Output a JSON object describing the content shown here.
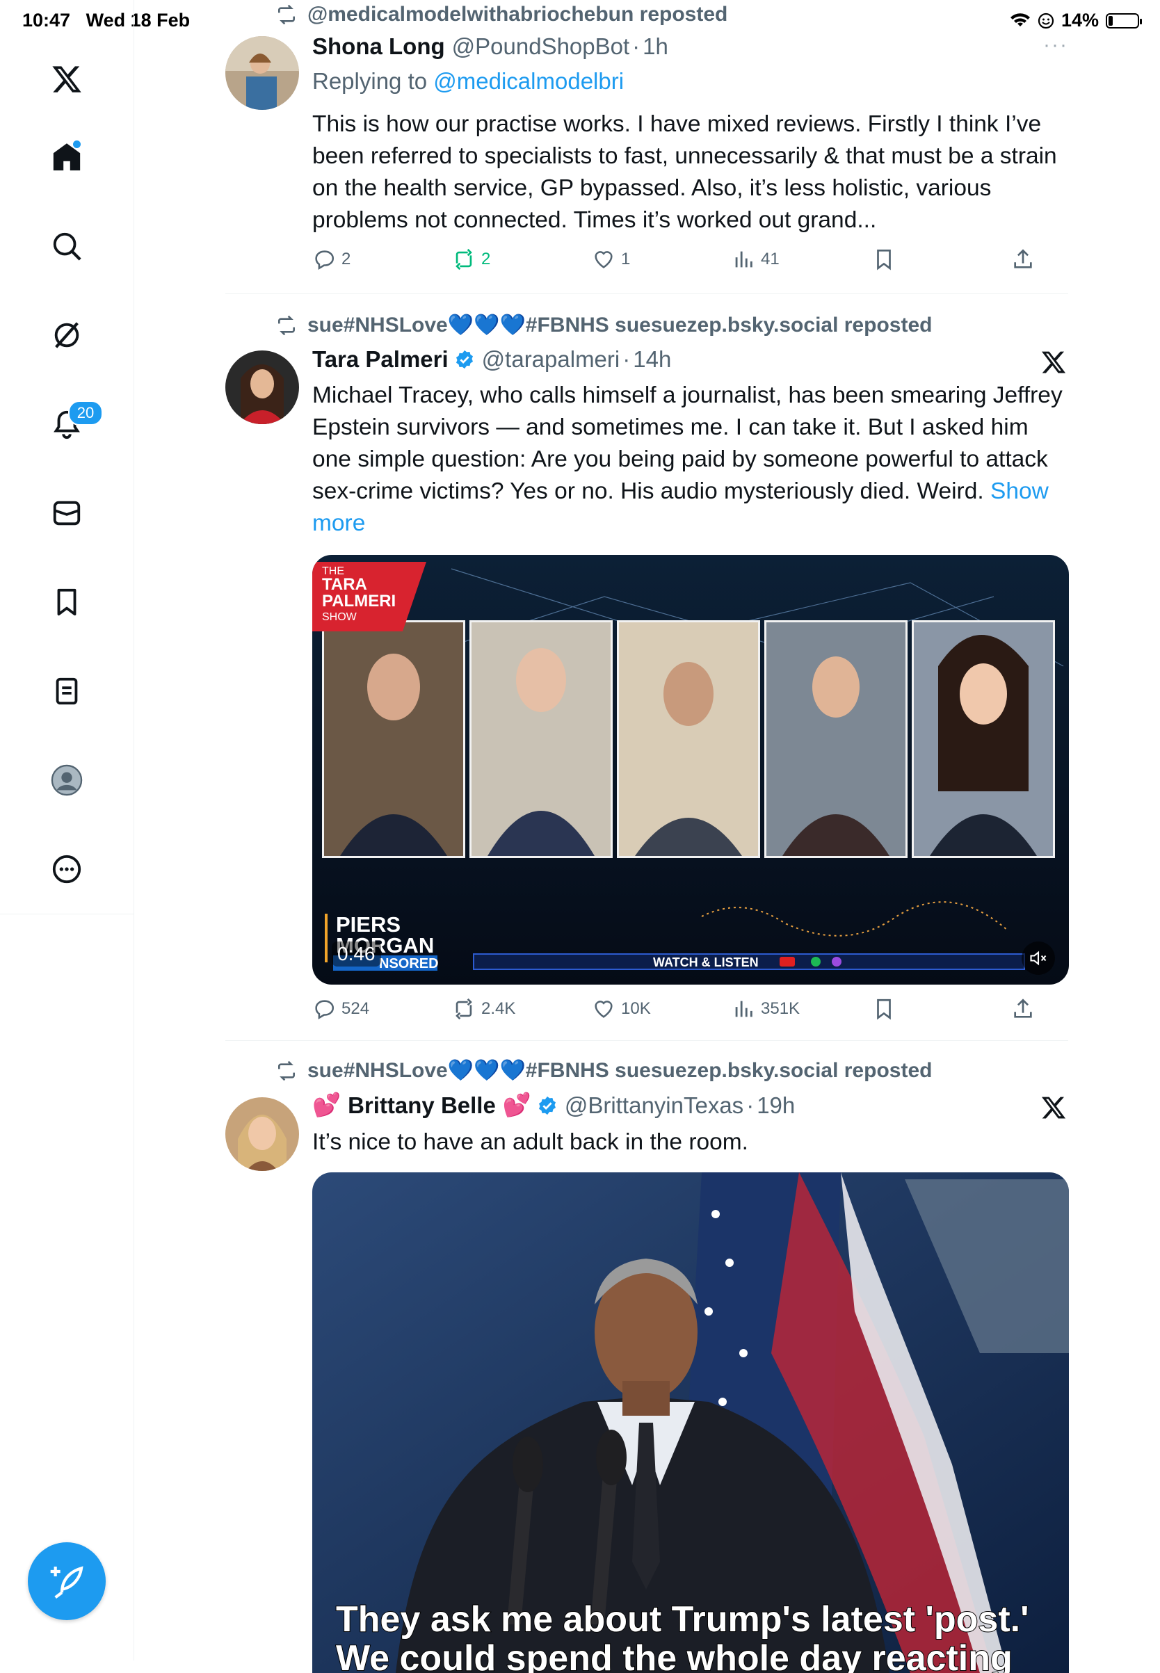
{
  "status_bar": {
    "time": "10:47",
    "date": "Wed 18 Feb",
    "battery": "14%",
    "battery_level": 0.14
  },
  "sidebar": {
    "notifications_badge": "20",
    "items": [
      "x-logo",
      "home",
      "explore",
      "grok",
      "notifications",
      "messages",
      "bookmarks",
      "lists",
      "profile",
      "more"
    ]
  },
  "tweets": [
    {
      "repost_by": "@medicalmodelwithabriochebun reposted",
      "name": "Shona Long",
      "handle": "@PoundShopBot",
      "sep": "·",
      "time": "1h",
      "more": "···",
      "reply_label": "Replying to",
      "reply_handle": "@medicalmodelbri",
      "text": "This is how our practise works. I have mixed reviews. Firstly I think I’ve been referred to specialists to fast, unnecessarily & that must be a strain on the health service, GP bypassed. Also, it’s less holistic, various problems not connected. Times it’s worked out grand...",
      "replies": "2",
      "reposts": "2",
      "likes": "1",
      "views": "41"
    },
    {
      "repost_by": "sue#NHSLove💙💙💙#FBNHS suesuezep.bsky.social reposted",
      "name": "Tara Palmeri",
      "handle": "@tarapalmeri",
      "sep": "·",
      "time": "14h",
      "text": "Michael Tracey, who calls himself a journalist, has been smearing Jeffrey Epstein survivors — and sometimes me. I can take it. But I asked him one simple question: Are you being paid by someone powerful to attack sex-crime victims? Yes or no. His audio mysteriously died. Weird.",
      "show_more": "Show more",
      "video": {
        "show_logo_line1": "THE",
        "show_logo_line2": "TARA",
        "show_logo_line3": "PALMERI",
        "show_logo_line4": "SHOW",
        "brand_line1": "PIERS",
        "brand_line2": "MORGAN",
        "brand_line3": "NSORED",
        "duration": "0:46",
        "ticker": "WATCH & LISTEN"
      },
      "replies": "524",
      "reposts": "2.4K",
      "likes": "10K",
      "views": "351K"
    },
    {
      "repost_by": "sue#NHSLove💙💙💙#FBNHS suesuezep.bsky.social reposted",
      "name_prefix": "💕",
      "name": "Brittany Belle",
      "name_suffix": "💕",
      "handle": "@BrittanyinTexas",
      "sep": "·",
      "time": "19h",
      "text": "It’s nice to have an adult back in the room.",
      "image_caption_line1": "They ask me about Trump's latest 'post.'",
      "image_caption_line2": "We could spend the whole day reacting"
    }
  ],
  "colors": {
    "accent": "#1d9bf0",
    "repost_green": "#00ba7c",
    "secondary_text": "#536471"
  }
}
